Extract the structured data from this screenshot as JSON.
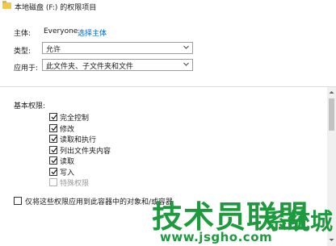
{
  "window": {
    "title": "本地磁盘 (F:) 的权限项目",
    "title_icon": "folder-icon"
  },
  "principal": {
    "label": "主体:",
    "value": "Everyone",
    "select_link": "选择主体"
  },
  "type": {
    "label": "类型:",
    "value": "允许"
  },
  "applies_to": {
    "label": "应用于:",
    "value": "此文件夹、子文件夹和文件"
  },
  "permissions": {
    "header": "基本权限:",
    "items": [
      {
        "label": "完全控制",
        "checked": true,
        "enabled": true
      },
      {
        "label": "修改",
        "checked": true,
        "enabled": true
      },
      {
        "label": "读取和执行",
        "checked": true,
        "enabled": true
      },
      {
        "label": "列出文件夹内容",
        "checked": true,
        "enabled": true
      },
      {
        "label": "读取",
        "checked": true,
        "enabled": true
      },
      {
        "label": "写入",
        "checked": true,
        "enabled": true
      },
      {
        "label": "特殊权限",
        "checked": false,
        "enabled": false
      }
    ]
  },
  "apply_only": {
    "label": "仅将这些权限应用到此容器中的对象和/或容器",
    "checked": false
  },
  "watermark": {
    "main": "技术员联盟",
    "suffix": "系统城",
    "url": "www.jsgho.com"
  },
  "colors": {
    "link": "#0066cc",
    "watermark": "#1e9a3e",
    "folder": "#f2c84b"
  }
}
